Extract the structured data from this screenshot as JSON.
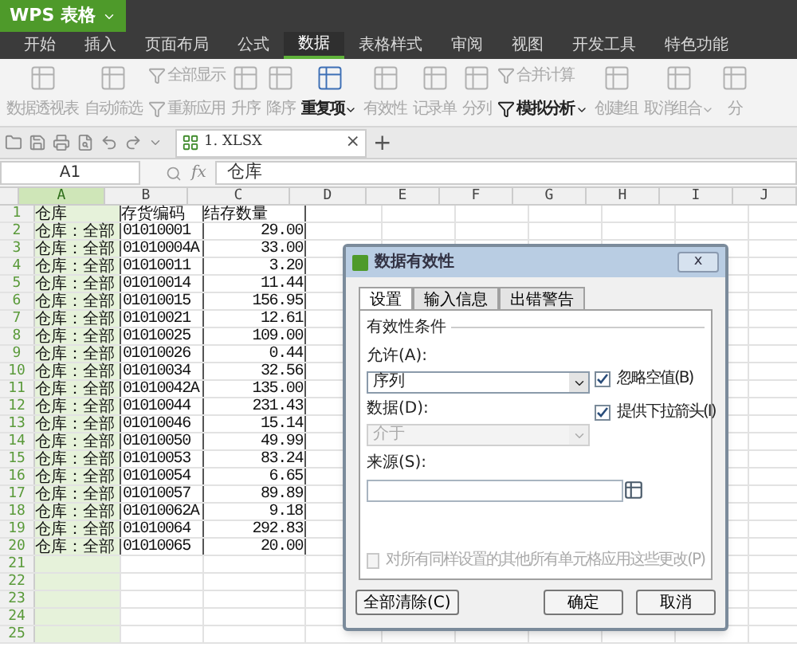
{
  "app": {
    "title": "WPS 表格"
  },
  "menu_tabs": [
    {
      "label": "开始",
      "selected": false
    },
    {
      "label": "插入",
      "selected": false
    },
    {
      "label": "页面布局",
      "selected": false
    },
    {
      "label": "公式",
      "selected": false
    },
    {
      "label": "数据",
      "selected": true
    },
    {
      "label": "表格样式",
      "selected": false
    },
    {
      "label": "审阅",
      "selected": false
    },
    {
      "label": "视图",
      "selected": false
    },
    {
      "label": "开发工具",
      "selected": false
    },
    {
      "label": "特色功能",
      "selected": false
    }
  ],
  "ribbon": [
    {
      "kind": "big",
      "label": "数据透视表",
      "disabled": true
    },
    {
      "kind": "big",
      "label": "自动筛选",
      "disabled": true
    },
    {
      "kind": "stack",
      "items": [
        {
          "label": "全部显示",
          "disabled": true
        },
        {
          "label": "重新应用",
          "disabled": true
        }
      ]
    },
    {
      "kind": "big",
      "label": "升序",
      "disabled": true
    },
    {
      "kind": "big",
      "label": "降序",
      "disabled": true
    },
    {
      "kind": "big",
      "label": "重复项",
      "disabled": false,
      "dropdown": true
    },
    {
      "kind": "big",
      "label": "有效性",
      "disabled": true
    },
    {
      "kind": "big",
      "label": "记录单",
      "disabled": true
    },
    {
      "kind": "big",
      "label": "分列",
      "disabled": true
    },
    {
      "kind": "stack",
      "items": [
        {
          "label": "合并计算",
          "disabled": true
        },
        {
          "label": "模拟分析",
          "disabled": false,
          "dropdown": true
        }
      ]
    },
    {
      "kind": "big",
      "label": "创建组",
      "disabled": true
    },
    {
      "kind": "big",
      "label": "取消组合",
      "disabled": true,
      "dropdown": true
    },
    {
      "kind": "big",
      "label": "分",
      "disabled": true
    }
  ],
  "doc_tab": {
    "label": "1. XLSX",
    "close": "×",
    "add": "+"
  },
  "formula_bar": {
    "name_box": "A1",
    "fx": "fx",
    "value": "仓库"
  },
  "columns": [
    {
      "label": "A",
      "selected": true
    },
    {
      "label": "B",
      "selected": false
    },
    {
      "label": "C",
      "selected": false
    },
    {
      "label": "D",
      "selected": false
    },
    {
      "label": "E",
      "selected": false
    },
    {
      "label": "F",
      "selected": false
    },
    {
      "label": "G",
      "selected": false
    },
    {
      "label": "H",
      "selected": false
    },
    {
      "label": "I",
      "selected": false
    },
    {
      "label": "J",
      "selected": false
    }
  ],
  "rows": [
    {
      "number": "1",
      "cells": [
        "仓库",
        "存货编码",
        "结存数量"
      ]
    },
    {
      "number": "2",
      "cells": [
        "仓库：全部",
        "01010001",
        "29.00"
      ]
    },
    {
      "number": "3",
      "cells": [
        "仓库：全部",
        "01010004A",
        "33.00"
      ]
    },
    {
      "number": "4",
      "cells": [
        "仓库：全部",
        "01010011",
        "3.20"
      ]
    },
    {
      "number": "5",
      "cells": [
        "仓库：全部",
        "01010014",
        "11.44"
      ]
    },
    {
      "number": "6",
      "cells": [
        "仓库：全部",
        "01010015",
        "156.95"
      ]
    },
    {
      "number": "7",
      "cells": [
        "仓库：全部",
        "01010021",
        "12.61"
      ]
    },
    {
      "number": "8",
      "cells": [
        "仓库：全部",
        "01010025",
        "109.00"
      ]
    },
    {
      "number": "9",
      "cells": [
        "仓库：全部",
        "01010026",
        "0.44"
      ]
    },
    {
      "number": "10",
      "cells": [
        "仓库：全部",
        "01010034",
        "32.56"
      ]
    },
    {
      "number": "11",
      "cells": [
        "仓库：全部",
        "01010042A",
        "135.00"
      ]
    },
    {
      "number": "12",
      "cells": [
        "仓库：全部",
        "01010044",
        "231.43"
      ]
    },
    {
      "number": "13",
      "cells": [
        "仓库：全部",
        "01010046",
        "15.14"
      ]
    },
    {
      "number": "14",
      "cells": [
        "仓库：全部",
        "01010050",
        "49.99"
      ]
    },
    {
      "number": "15",
      "cells": [
        "仓库：全部",
        "01010053",
        "83.24"
      ]
    },
    {
      "number": "16",
      "cells": [
        "仓库：全部",
        "01010054",
        "6.65"
      ]
    },
    {
      "number": "17",
      "cells": [
        "仓库：全部",
        "01010057",
        "89.89"
      ]
    },
    {
      "number": "18",
      "cells": [
        "仓库：全部",
        "01010062A",
        "9.18"
      ]
    },
    {
      "number": "19",
      "cells": [
        "仓库：全部",
        "01010064",
        "292.83"
      ]
    },
    {
      "number": "20",
      "cells": [
        "仓库：全部",
        "01010065",
        "20.00"
      ]
    },
    {
      "number": "21",
      "cells": []
    },
    {
      "number": "22",
      "cells": []
    },
    {
      "number": "23",
      "cells": []
    },
    {
      "number": "24",
      "cells": []
    },
    {
      "number": "25",
      "cells": []
    }
  ],
  "dialog": {
    "title": "数据有效性",
    "close": "x",
    "tabs": [
      {
        "label": "设置",
        "selected": true
      },
      {
        "label": "输入信息",
        "selected": false
      },
      {
        "label": "出错警告",
        "selected": false
      }
    ],
    "group_title": "有效性条件",
    "allow": {
      "label": "允许(A):",
      "value": "序列",
      "disabled": false
    },
    "data": {
      "label": "数据(D):",
      "value": "介于",
      "disabled": true
    },
    "checks": [
      {
        "label": "忽略空值(B)",
        "checked": true
      },
      {
        "label": "提供下拉箭头(I)",
        "checked": true
      }
    ],
    "source": {
      "label": "来源(S):"
    },
    "apply_all": {
      "label": "对所有同样设置的其他所有单元格应用这些更改(P)",
      "checked": false,
      "disabled": true
    },
    "buttons": [
      {
        "label": "全部清除(C)",
        "kind": "left"
      },
      {
        "label": "确定",
        "kind": "right"
      },
      {
        "label": "取消",
        "kind": "right"
      }
    ]
  }
}
